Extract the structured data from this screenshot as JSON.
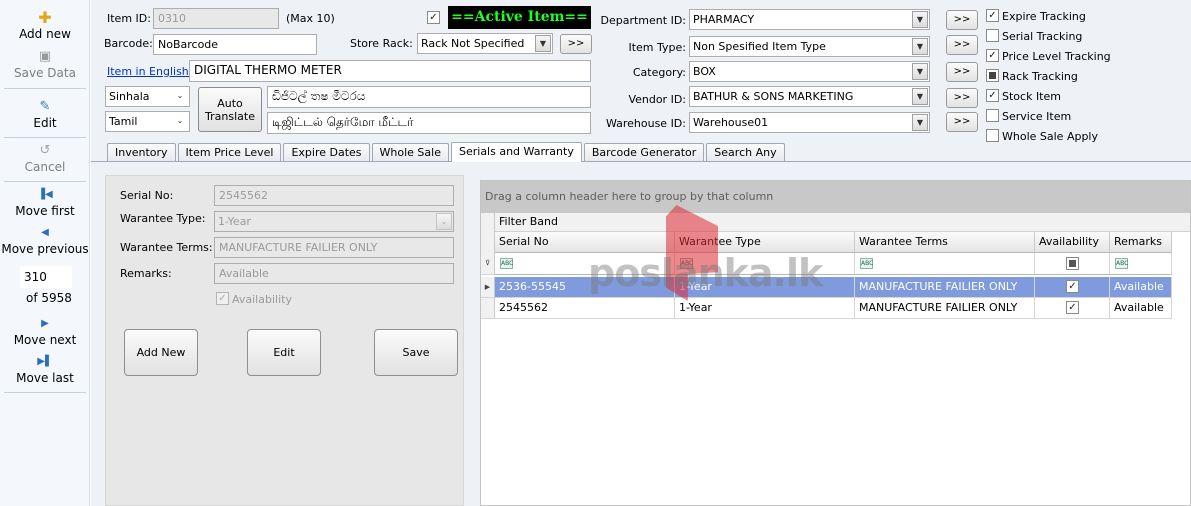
{
  "sidebar": {
    "add_new": "Add new",
    "save_data": "Save Data",
    "edit": "Edit",
    "cancel": "Cancel",
    "move_first": "Move first",
    "move_previous": "Move previous",
    "record_position": "310",
    "record_count": "of 5958",
    "move_next": "Move next",
    "move_last": "Move last"
  },
  "item": {
    "item_id_label": "Item ID:",
    "item_id_value": "0310",
    "max_note": "(Max 10)",
    "active_badge": "==Active Item==",
    "barcode_label": "Barcode:",
    "barcode_value": "NoBarcode",
    "store_rack_label": "Store Rack:",
    "store_rack_value": "Rack Not Specified",
    "english_link": "Item in English:",
    "english_value": "DIGITAL THERMO METER",
    "lang1": "Sinhala",
    "lang1_value": "ඩිජිටල් තෂ මීටරය",
    "lang2": "Tamil",
    "lang2_value": "டிஜிட்டல் தெர்மோ மீட்டர்",
    "auto_translate": "Auto Translate"
  },
  "classification": {
    "department_label": "Department ID:",
    "department_value": "PHARMACY",
    "item_type_label": "Item Type:",
    "item_type_value": "Non Spesified Item Type",
    "category_label": "Category:",
    "category_value": "BOX",
    "vendor_label": "Vendor ID:",
    "vendor_value": "BATHUR & SONS MARKETING",
    "warehouse_label": "Warehouse ID:",
    "warehouse_value": "Warehouse01",
    "more_label": ">>"
  },
  "options": [
    {
      "label": "Expire Tracking",
      "checked": true
    },
    {
      "label": "Serial Tracking",
      "checked": false
    },
    {
      "label": "Price Level Tracking",
      "checked": true
    },
    {
      "label": "Rack Tracking",
      "checked": "indeterminate"
    },
    {
      "label": "Stock Item",
      "checked": true
    },
    {
      "label": "Service Item",
      "checked": false
    },
    {
      "label": "Whole Sale Apply",
      "checked": false
    }
  ],
  "tabs": [
    "Inventory",
    "Item Price Level",
    "Expire Dates",
    "Whole Sale",
    "Serials and Warranty",
    "Barcode Generator",
    "Search Any"
  ],
  "active_tab": "Serials and Warranty",
  "serial_form": {
    "serial_no_label": "Serial No:",
    "serial_no_value": "2545562",
    "warrantee_type_label": "Warantee Type:",
    "warrantee_type_value": "1-Year",
    "warrantee_terms_label": "Warantee Terms:",
    "warrantee_terms_value": "MANUFACTURE FAILIER ONLY",
    "remarks_label": "Remarks:",
    "remarks_value": "Available",
    "availability_label": "Availability",
    "add_new_btn": "Add New",
    "edit_btn": "Edit",
    "save_btn": "Save"
  },
  "grid": {
    "group_hint": "Drag a column header here to group by that column",
    "filter_band": "Filter Band",
    "columns": [
      "Serial No",
      "Warantee Type",
      "Warantee Terms",
      "Availability",
      "Remarks"
    ],
    "filter_chip": "ABC",
    "rows": [
      {
        "serial": "2536-55545",
        "type": "1-Year",
        "terms": "MANUFACTURE FAILIER ONLY",
        "available": true,
        "remarks": "Available",
        "selected": true
      },
      {
        "serial": "2545562",
        "type": "1-Year",
        "terms": "MANUFACTURE FAILIER ONLY",
        "available": true,
        "remarks": "Available",
        "selected": false
      }
    ]
  },
  "watermark": {
    "text": "poslanka.lk"
  },
  "colors": {
    "badge_bg": "#000000",
    "badge_text": "#1fff27",
    "selected_row": "#7f9bdd",
    "link": "#0033cc"
  }
}
